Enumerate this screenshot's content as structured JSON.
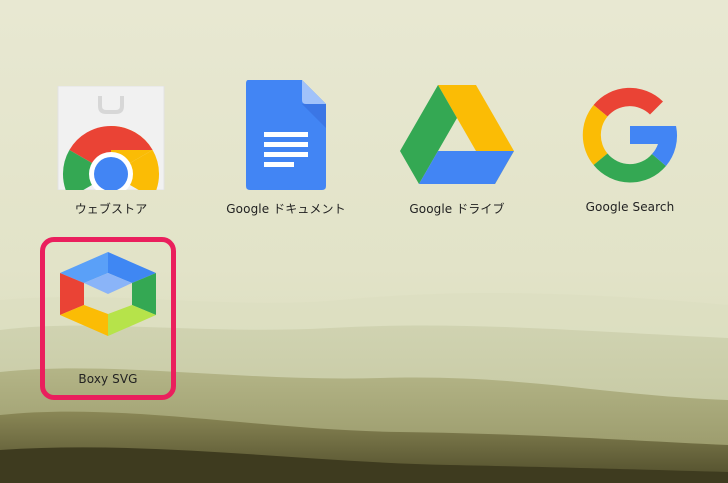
{
  "apps": [
    {
      "label": "ウェブストア",
      "icon": "chrome-web-store-icon"
    },
    {
      "label": "Google ドキュメント",
      "icon": "google-docs-icon"
    },
    {
      "label": "Google ドライブ",
      "icon": "google-drive-icon"
    },
    {
      "label": "Google Search",
      "icon": "google-search-icon"
    },
    {
      "label": "Boxy SVG",
      "icon": "boxy-svg-icon"
    }
  ],
  "colors": {
    "highlight": "#ea1f5d",
    "google_blue": "#4285f4",
    "google_red": "#ea4335",
    "google_yellow": "#fbbc05",
    "google_green": "#34a853"
  }
}
